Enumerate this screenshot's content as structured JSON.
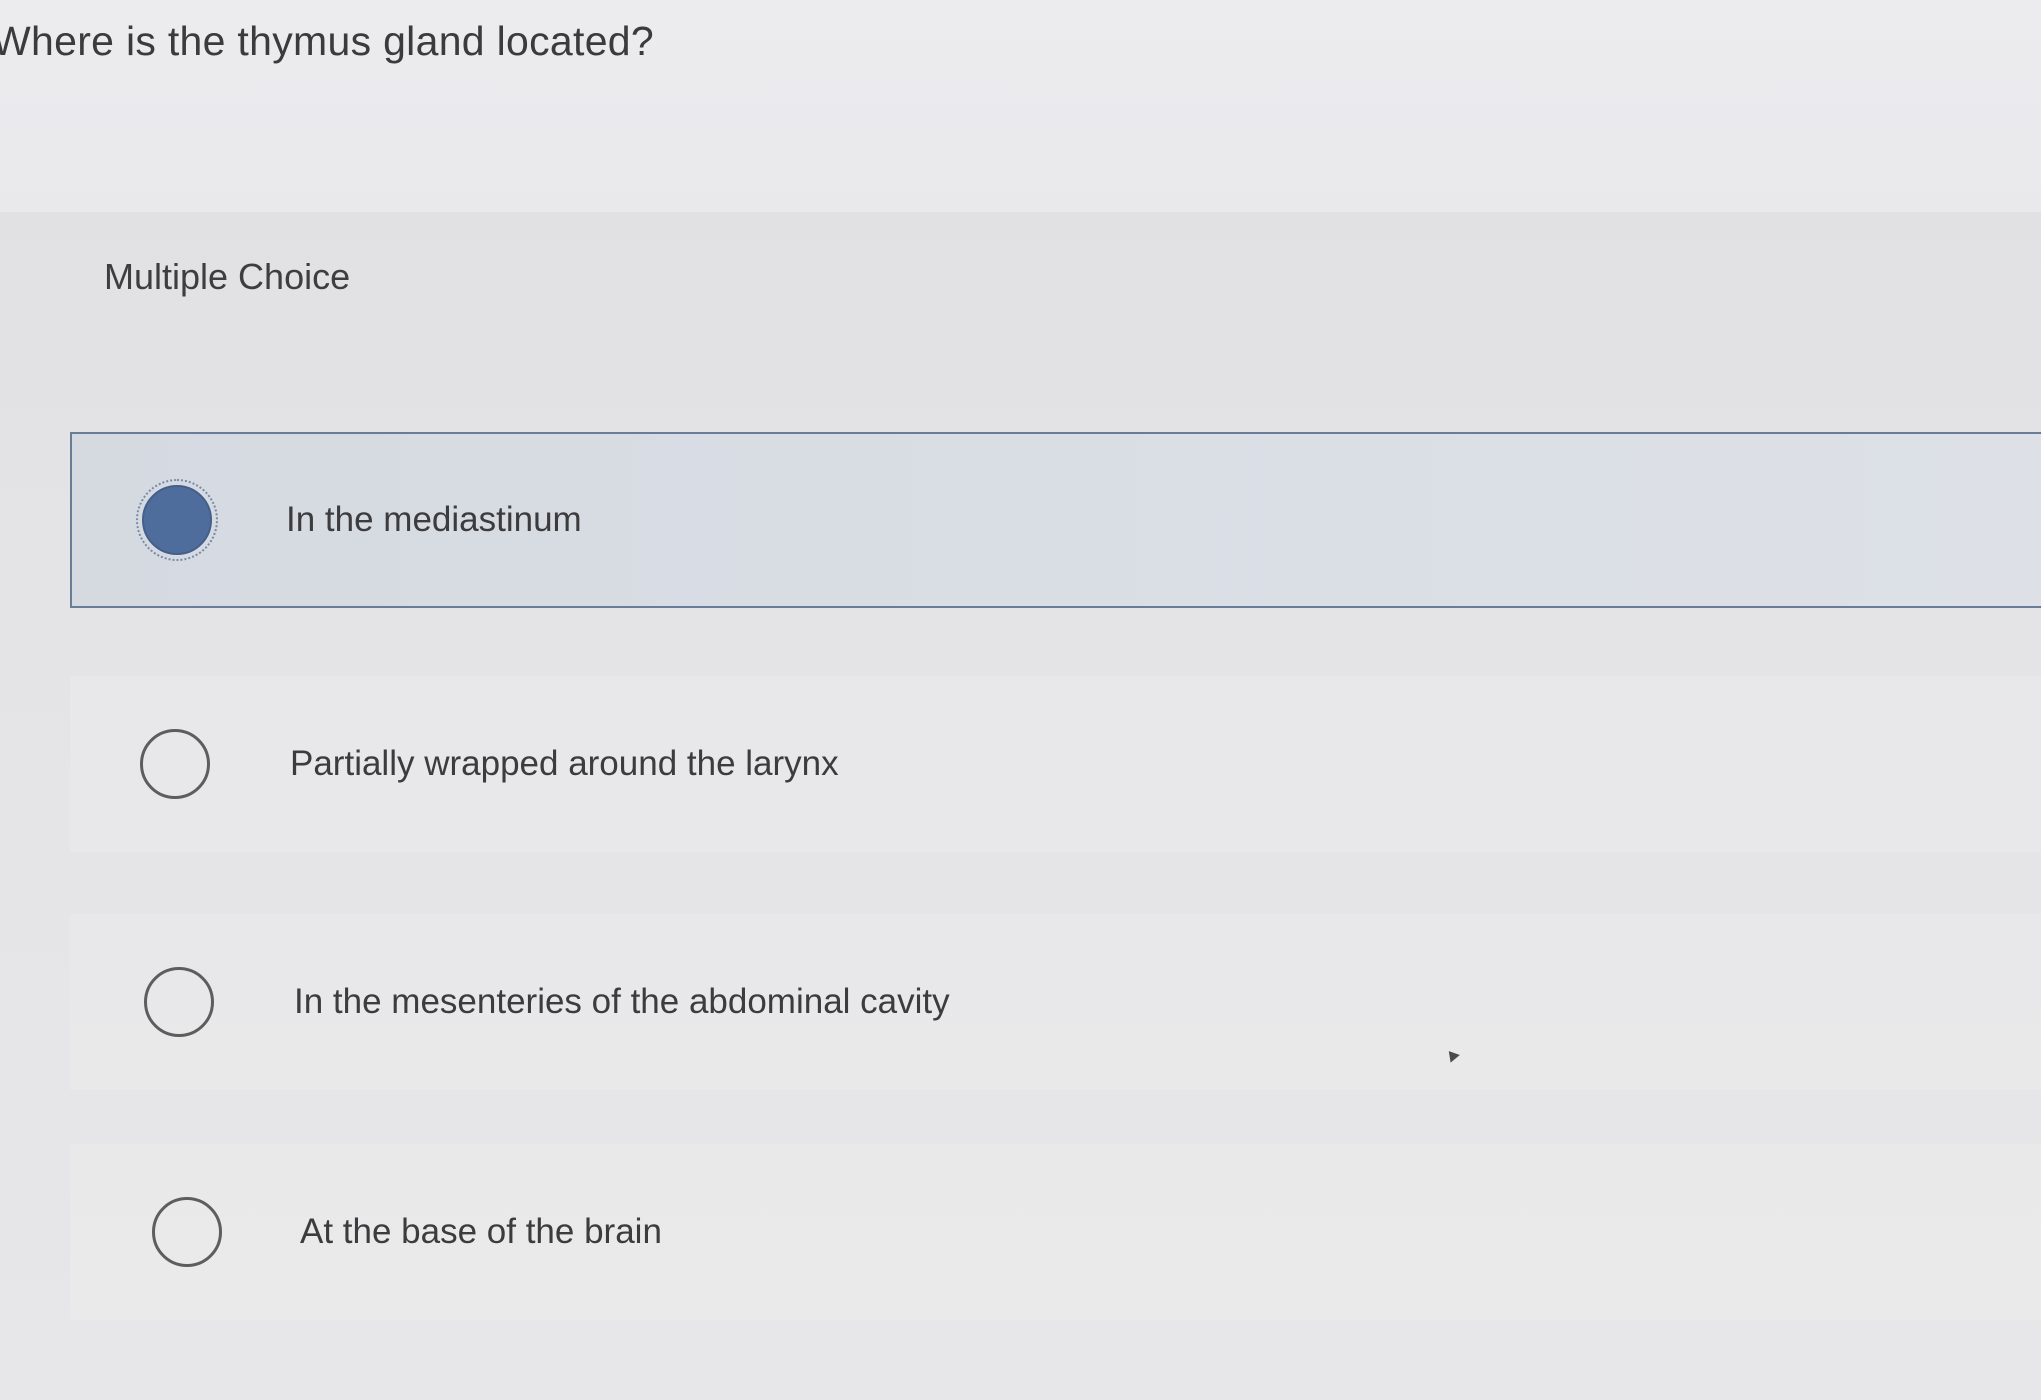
{
  "question": {
    "text": "Where is the thymus gland located?"
  },
  "question_type": "Multiple Choice",
  "options": [
    {
      "label": "In the mediastinum",
      "selected": true
    },
    {
      "label": "Partially wrapped around the larynx",
      "selected": false
    },
    {
      "label": "In the mesenteries of the abdominal cavity",
      "selected": false
    },
    {
      "label": "At the base of the brain",
      "selected": false
    }
  ],
  "colors": {
    "background": "#e8e8ea",
    "selected_fill": "#d9dee5",
    "selected_border": "#6a7c96",
    "radio_selected": "#4f6d9c",
    "text": "#3c3c3e"
  }
}
